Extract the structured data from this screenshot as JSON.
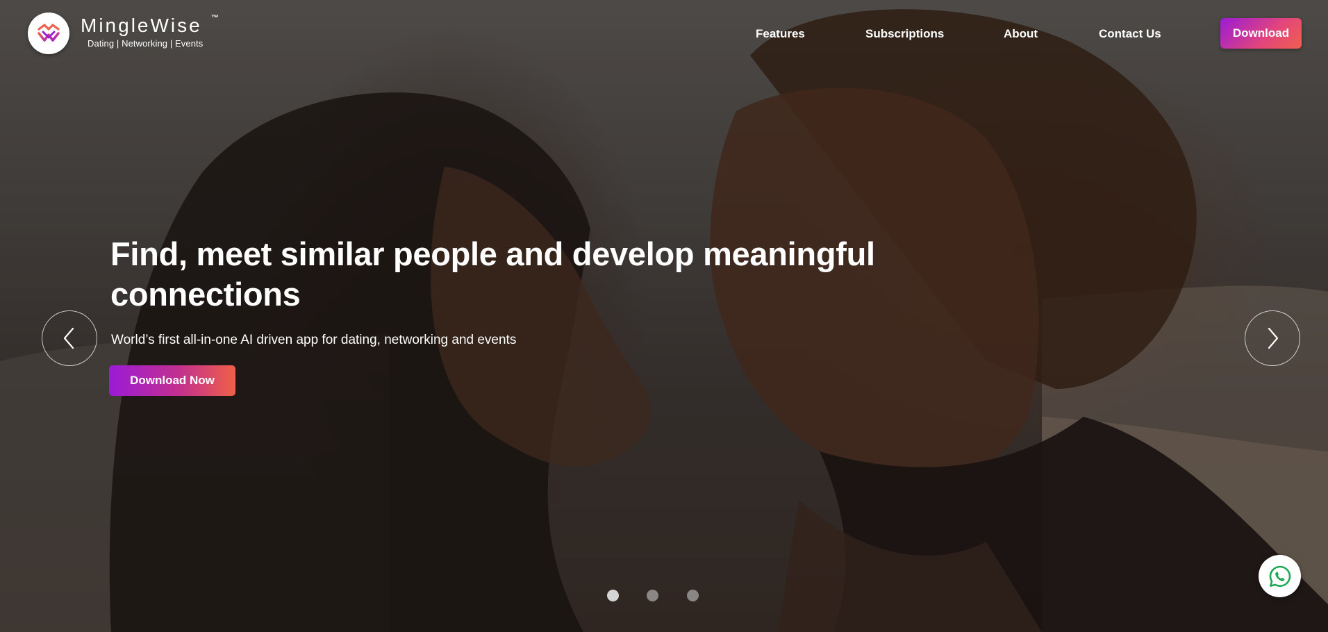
{
  "brand": {
    "name": "MingleWise",
    "trademark": "™",
    "tagline": "Dating | Networking | Events",
    "logo_icon": "minglewise-logo-icon"
  },
  "nav": {
    "items": [
      {
        "label": "Features"
      },
      {
        "label": "Subscriptions"
      },
      {
        "label": "About"
      },
      {
        "label": "Contact Us"
      }
    ],
    "download_label": "Download"
  },
  "hero": {
    "title": "Find, meet similar people and develop meaningful connections",
    "subtitle": "World’s first all-in-one AI driven app for dating, networking and events",
    "cta_label": "Download Now",
    "prev_icon": "chevron-left-icon",
    "next_icon": "chevron-right-icon"
  },
  "carousel": {
    "slide_count": 3,
    "active_index": 0
  },
  "floating": {
    "whatsapp_icon": "whatsapp-icon"
  },
  "colors": {
    "accent_start": "#9b1bd6",
    "accent_end": "#f0604f",
    "whatsapp": "#1fa855"
  }
}
